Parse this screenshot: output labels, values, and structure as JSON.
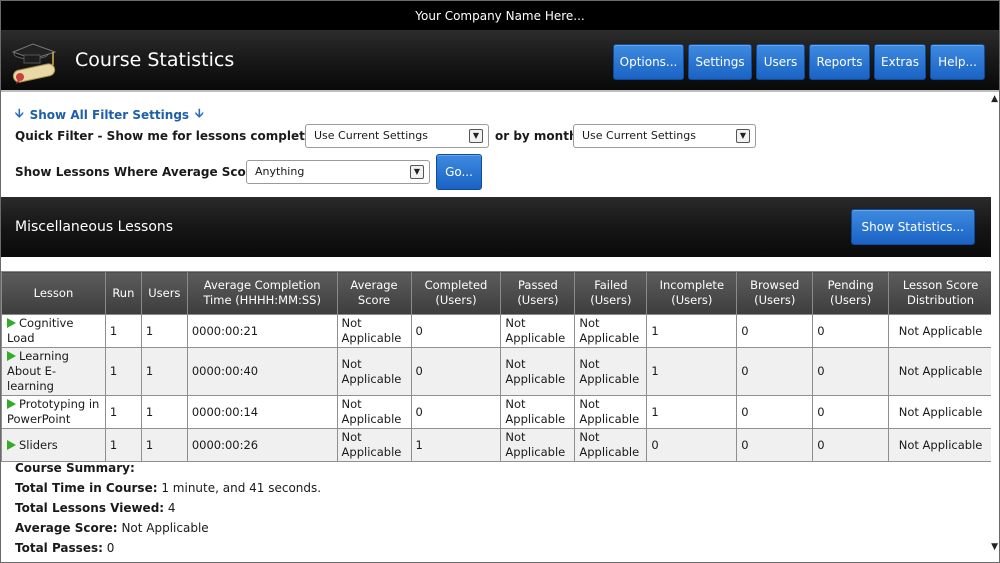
{
  "company_name": "Your Company Name Here...",
  "app": {
    "title": "Course Statistics"
  },
  "nav": [
    {
      "label": "Options..."
    },
    {
      "label": "Settings"
    },
    {
      "label": "Users"
    },
    {
      "label": "Reports"
    },
    {
      "label": "Extras"
    },
    {
      "label": "Help..."
    }
  ],
  "filters": {
    "toggle_label": "Show All Filter Settings",
    "quick_filter_label": "Quick Filter - Show me for lessons completed as of:",
    "completed_as_of_value": "Use Current Settings",
    "by_month_label": "or by month:",
    "by_month_value": "Use Current Settings",
    "avg_score_label": "Show Lessons Where Average Score is:",
    "avg_score_value": "Anything",
    "go_label": "Go..."
  },
  "section": {
    "title": "Miscellaneous Lessons",
    "show_stats_label": "Show Statistics..."
  },
  "table": {
    "headers": [
      "Lesson",
      "Run",
      "Users",
      "Average Completion Time (HHHH:MM:SS)",
      "Average Score",
      "Completed (Users)",
      "Passed (Users)",
      "Failed (Users)",
      "Incomplete (Users)",
      "Browsed (Users)",
      "Pending (Users)",
      "Lesson Score Distribution"
    ],
    "rows": [
      {
        "lesson": "Cognitive Load",
        "run": "1",
        "users": "1",
        "time": "0000:00:21",
        "avg": "Not Applicable",
        "completed": "0",
        "passed": "Not Applicable",
        "failed": "Not Applicable",
        "incomplete": "1",
        "browsed": "0",
        "pending": "0",
        "dist": "Not Applicable"
      },
      {
        "lesson": "Learning About E-learning",
        "run": "1",
        "users": "1",
        "time": "0000:00:40",
        "avg": "Not Applicable",
        "completed": "0",
        "passed": "Not Applicable",
        "failed": "Not Applicable",
        "incomplete": "1",
        "browsed": "0",
        "pending": "0",
        "dist": "Not Applicable"
      },
      {
        "lesson": "Prototyping in PowerPoint",
        "run": "1",
        "users": "1",
        "time": "0000:00:14",
        "avg": "Not Applicable",
        "completed": "0",
        "passed": "Not Applicable",
        "failed": "Not Applicable",
        "incomplete": "1",
        "browsed": "0",
        "pending": "0",
        "dist": "Not Applicable"
      },
      {
        "lesson": "Sliders",
        "run": "1",
        "users": "1",
        "time": "0000:00:26",
        "avg": "Not Applicable",
        "completed": "1",
        "passed": "Not Applicable",
        "failed": "Not Applicable",
        "incomplete": "0",
        "browsed": "0",
        "pending": "0",
        "dist": "Not Applicable"
      }
    ]
  },
  "summary": {
    "heading": "Course Summary:",
    "time_label": "Total Time in Course:",
    "time_value": "1 minute, and 41 seconds.",
    "viewed_label": "Total Lessons Viewed:",
    "viewed_value": "4",
    "avg_label": "Average Score:",
    "avg_value": "Not Applicable",
    "passes_label": "Total Passes:",
    "passes_value": "0"
  },
  "colors": {
    "button_blue": "#1a63c4",
    "header_dark": "#1a1a1a",
    "link_blue": "#1d5fa8",
    "play_green": "#33aa2a"
  }
}
